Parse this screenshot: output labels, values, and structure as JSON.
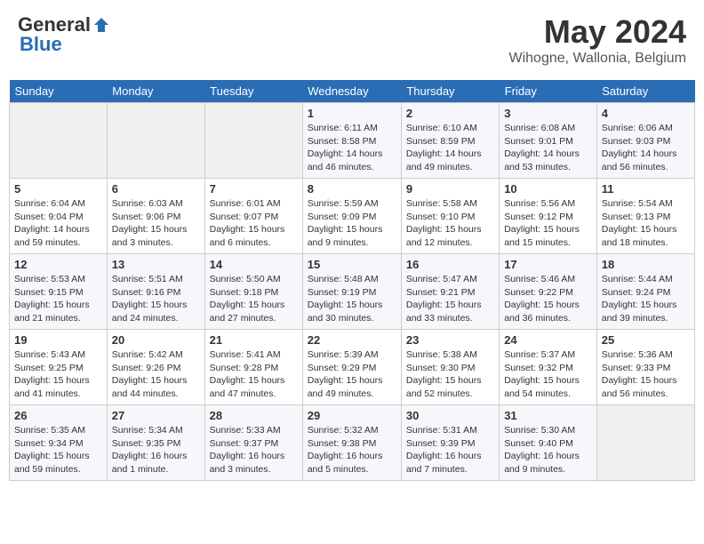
{
  "header": {
    "logo_general": "General",
    "logo_blue": "Blue",
    "month": "May 2024",
    "location": "Wihogne, Wallonia, Belgium"
  },
  "days_of_week": [
    "Sunday",
    "Monday",
    "Tuesday",
    "Wednesday",
    "Thursday",
    "Friday",
    "Saturday"
  ],
  "weeks": [
    [
      {
        "day": "",
        "info": ""
      },
      {
        "day": "",
        "info": ""
      },
      {
        "day": "",
        "info": ""
      },
      {
        "day": "1",
        "info": "Sunrise: 6:11 AM\nSunset: 8:58 PM\nDaylight: 14 hours\nand 46 minutes."
      },
      {
        "day": "2",
        "info": "Sunrise: 6:10 AM\nSunset: 8:59 PM\nDaylight: 14 hours\nand 49 minutes."
      },
      {
        "day": "3",
        "info": "Sunrise: 6:08 AM\nSunset: 9:01 PM\nDaylight: 14 hours\nand 53 minutes."
      },
      {
        "day": "4",
        "info": "Sunrise: 6:06 AM\nSunset: 9:03 PM\nDaylight: 14 hours\nand 56 minutes."
      }
    ],
    [
      {
        "day": "5",
        "info": "Sunrise: 6:04 AM\nSunset: 9:04 PM\nDaylight: 14 hours\nand 59 minutes."
      },
      {
        "day": "6",
        "info": "Sunrise: 6:03 AM\nSunset: 9:06 PM\nDaylight: 15 hours\nand 3 minutes."
      },
      {
        "day": "7",
        "info": "Sunrise: 6:01 AM\nSunset: 9:07 PM\nDaylight: 15 hours\nand 6 minutes."
      },
      {
        "day": "8",
        "info": "Sunrise: 5:59 AM\nSunset: 9:09 PM\nDaylight: 15 hours\nand 9 minutes."
      },
      {
        "day": "9",
        "info": "Sunrise: 5:58 AM\nSunset: 9:10 PM\nDaylight: 15 hours\nand 12 minutes."
      },
      {
        "day": "10",
        "info": "Sunrise: 5:56 AM\nSunset: 9:12 PM\nDaylight: 15 hours\nand 15 minutes."
      },
      {
        "day": "11",
        "info": "Sunrise: 5:54 AM\nSunset: 9:13 PM\nDaylight: 15 hours\nand 18 minutes."
      }
    ],
    [
      {
        "day": "12",
        "info": "Sunrise: 5:53 AM\nSunset: 9:15 PM\nDaylight: 15 hours\nand 21 minutes."
      },
      {
        "day": "13",
        "info": "Sunrise: 5:51 AM\nSunset: 9:16 PM\nDaylight: 15 hours\nand 24 minutes."
      },
      {
        "day": "14",
        "info": "Sunrise: 5:50 AM\nSunset: 9:18 PM\nDaylight: 15 hours\nand 27 minutes."
      },
      {
        "day": "15",
        "info": "Sunrise: 5:48 AM\nSunset: 9:19 PM\nDaylight: 15 hours\nand 30 minutes."
      },
      {
        "day": "16",
        "info": "Sunrise: 5:47 AM\nSunset: 9:21 PM\nDaylight: 15 hours\nand 33 minutes."
      },
      {
        "day": "17",
        "info": "Sunrise: 5:46 AM\nSunset: 9:22 PM\nDaylight: 15 hours\nand 36 minutes."
      },
      {
        "day": "18",
        "info": "Sunrise: 5:44 AM\nSunset: 9:24 PM\nDaylight: 15 hours\nand 39 minutes."
      }
    ],
    [
      {
        "day": "19",
        "info": "Sunrise: 5:43 AM\nSunset: 9:25 PM\nDaylight: 15 hours\nand 41 minutes."
      },
      {
        "day": "20",
        "info": "Sunrise: 5:42 AM\nSunset: 9:26 PM\nDaylight: 15 hours\nand 44 minutes."
      },
      {
        "day": "21",
        "info": "Sunrise: 5:41 AM\nSunset: 9:28 PM\nDaylight: 15 hours\nand 47 minutes."
      },
      {
        "day": "22",
        "info": "Sunrise: 5:39 AM\nSunset: 9:29 PM\nDaylight: 15 hours\nand 49 minutes."
      },
      {
        "day": "23",
        "info": "Sunrise: 5:38 AM\nSunset: 9:30 PM\nDaylight: 15 hours\nand 52 minutes."
      },
      {
        "day": "24",
        "info": "Sunrise: 5:37 AM\nSunset: 9:32 PM\nDaylight: 15 hours\nand 54 minutes."
      },
      {
        "day": "25",
        "info": "Sunrise: 5:36 AM\nSunset: 9:33 PM\nDaylight: 15 hours\nand 56 minutes."
      }
    ],
    [
      {
        "day": "26",
        "info": "Sunrise: 5:35 AM\nSunset: 9:34 PM\nDaylight: 15 hours\nand 59 minutes."
      },
      {
        "day": "27",
        "info": "Sunrise: 5:34 AM\nSunset: 9:35 PM\nDaylight: 16 hours\nand 1 minute."
      },
      {
        "day": "28",
        "info": "Sunrise: 5:33 AM\nSunset: 9:37 PM\nDaylight: 16 hours\nand 3 minutes."
      },
      {
        "day": "29",
        "info": "Sunrise: 5:32 AM\nSunset: 9:38 PM\nDaylight: 16 hours\nand 5 minutes."
      },
      {
        "day": "30",
        "info": "Sunrise: 5:31 AM\nSunset: 9:39 PM\nDaylight: 16 hours\nand 7 minutes."
      },
      {
        "day": "31",
        "info": "Sunrise: 5:30 AM\nSunset: 9:40 PM\nDaylight: 16 hours\nand 9 minutes."
      },
      {
        "day": "",
        "info": ""
      }
    ]
  ]
}
